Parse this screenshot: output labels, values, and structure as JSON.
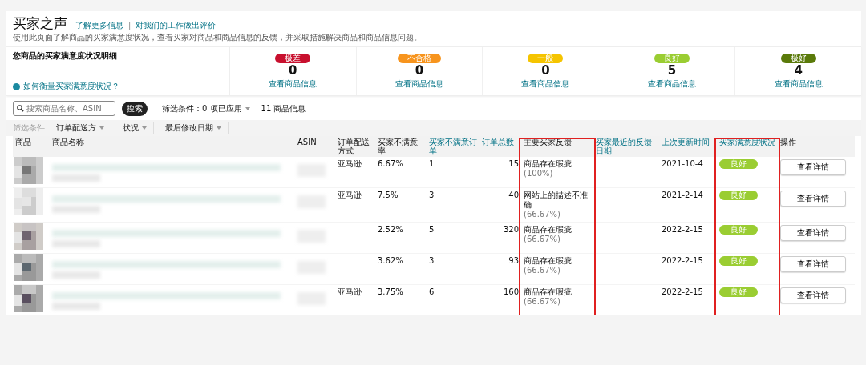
{
  "header": {
    "title": "买家之声",
    "links": [
      "了解更多信息",
      "对我们的工作做出评价"
    ],
    "separator": "|",
    "description": "使用此页面了解商品的买家满意度状况，查看买家对商品和商品信息的反馈，并采取措施解决商品和商品信息问题。"
  },
  "summary": {
    "heading": "您商品的买家满意度状况明细",
    "help_link": "如何衡量买家满意度状况？",
    "levels": [
      {
        "badge": "极差",
        "color": "#c8102e",
        "count": "0",
        "link": "查看商品信息"
      },
      {
        "badge": "不合格",
        "color": "#f7941d",
        "count": "0",
        "link": "查看商品信息"
      },
      {
        "badge": "一般",
        "color": "#f5c400",
        "count": "0",
        "link": "查看商品信息"
      },
      {
        "badge": "良好",
        "color": "#9acd32",
        "count": "5",
        "link": "查看商品信息"
      },
      {
        "badge": "极好",
        "color": "#5a7a0a",
        "count": "4",
        "link": "查看商品信息"
      }
    ]
  },
  "toolbar": {
    "search": {
      "placeholder": "搜索商品名称、ASIN"
    },
    "search_button": "搜索",
    "filter_status": "筛选条件：0 项已应用",
    "result_count": "11 商品信息"
  },
  "filters": {
    "label": "筛选条件",
    "dropdowns": [
      "订单配送方",
      "状况",
      "最后修改日期"
    ]
  },
  "table": {
    "columns": [
      {
        "label": "商品",
        "link": false,
        "highlighted": false
      },
      {
        "label": "商品名称",
        "link": false,
        "highlighted": false
      },
      {
        "label": "ASIN",
        "link": false,
        "highlighted": false
      },
      {
        "label": "订单配送方式",
        "link": false,
        "highlighted": false
      },
      {
        "label": "买家不满意率",
        "link": false,
        "highlighted": false
      },
      {
        "label": "买家不满意订单",
        "link": true,
        "highlighted": false
      },
      {
        "label": "订单总数",
        "link": true,
        "highlighted": false
      },
      {
        "label": "主要买家反馈",
        "link": false,
        "highlighted": true
      },
      {
        "label": "买家最近的反馈日期",
        "link": true,
        "highlighted": false
      },
      {
        "label": "上次更新时间",
        "link": true,
        "highlighted": false
      },
      {
        "label": "买家满意度状况",
        "link": true,
        "highlighted": true
      },
      {
        "label": "操作",
        "link": false,
        "highlighted": false
      }
    ],
    "rows": [
      {
        "fulfillment": "亚马逊",
        "rate": "6.67%",
        "orders": "1",
        "total": "15",
        "feedback": "商品存在瑕疵",
        "share": "(100%)",
        "updated": "2021-10-4",
        "status": "良好",
        "color": "#9acd32",
        "action": "查看详情"
      },
      {
        "fulfillment": "亚马逊",
        "rate": "7.5%",
        "orders": "3",
        "total": "40",
        "feedback": "网站上的描述不准确",
        "share": "(66.67%)",
        "updated": "2021-2-14",
        "status": "良好",
        "color": "#9acd32",
        "action": "查看详情"
      },
      {
        "rate": "2.52%",
        "orders": "5",
        "total": "320",
        "feedback": "商品存在瑕疵",
        "share": "(66.67%)",
        "updated": "2022-2-15",
        "status": "良好",
        "color": "#9acd32",
        "action": "查看详情"
      },
      {
        "rate": "3.62%",
        "orders": "3",
        "total": "93",
        "feedback": "商品存在瑕疵",
        "share": "(66.67%)",
        "updated": "2022-2-15",
        "status": "良好",
        "color": "#9acd32",
        "action": "查看详情"
      },
      {
        "fulfillment": "亚马逊",
        "rate": "3.75%",
        "orders": "6",
        "total": "160",
        "feedback": "商品存在瑕疵",
        "share": "(66.67%)",
        "updated": "2022-2-15",
        "status": "良好",
        "color": "#9acd32",
        "action": "查看详情"
      }
    ]
  }
}
